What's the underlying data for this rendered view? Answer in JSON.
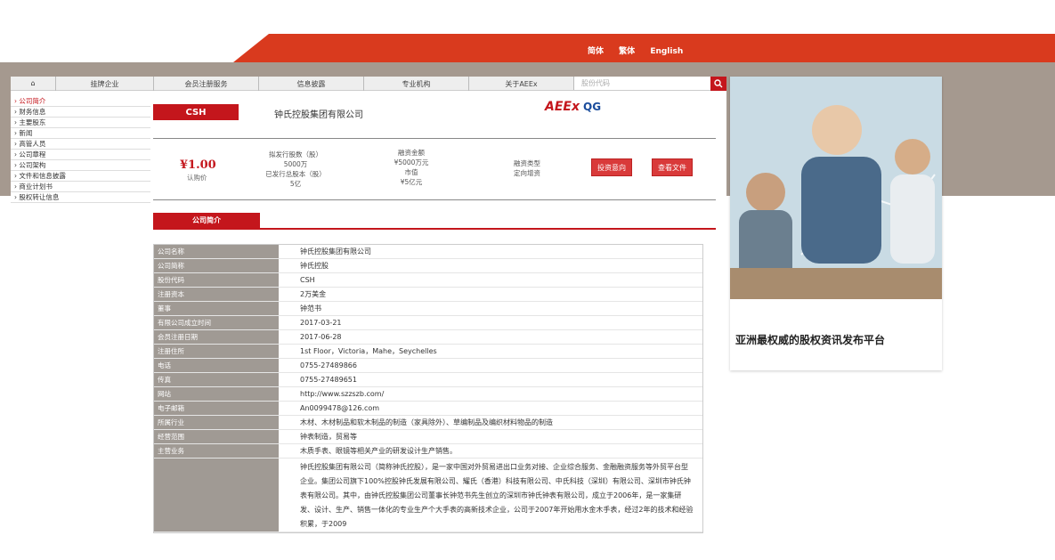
{
  "lang": [
    "简体",
    "繁体",
    "English"
  ],
  "nav": {
    "items": [
      "挂牌企业",
      "会员注册服务",
      "信息披露",
      "专业机构",
      "关于AEEx"
    ],
    "search_placeholder": "股份代码"
  },
  "sidebar": [
    "公司简介",
    "财务信息",
    "主要股东",
    "新闻",
    "高管人员",
    "公司章程",
    "公司架构",
    "文件和信息披露",
    "商业计划书",
    "股权转让信息"
  ],
  "header": {
    "code": "CSH",
    "company": "钟氏控股集团有限公司",
    "logo_aeex": "AEEx",
    "logo_qg": "QG"
  },
  "stats": {
    "price": "¥1.00",
    "price_label": "认购价",
    "col1_l1": "拟发行股数（股）",
    "col1_l2": "5000万",
    "col1_l3": "已发行总股本（股）",
    "col1_l4": "5亿",
    "col2_l1": "融资金额",
    "col2_l2": "¥5000万元",
    "col2_l3": "市值",
    "col2_l4": "¥5亿元",
    "col3_l1": "融资类型",
    "col3_l2": "定向增资",
    "btn_invest": "投资意向",
    "btn_docs": "查看文件"
  },
  "section_tab": "公司简介",
  "table": [
    {
      "k": "公司名称",
      "v": "钟氏控股集团有限公司"
    },
    {
      "k": "公司简称",
      "v": "钟氏控股"
    },
    {
      "k": "股份代码",
      "v": "CSH"
    },
    {
      "k": "注册资本",
      "v": "2万美金"
    },
    {
      "k": "董事",
      "v": "钟范书"
    },
    {
      "k": "有限公司成立时间",
      "v": "2017-03-21"
    },
    {
      "k": "会员注册日期",
      "v": "2017-06-28"
    },
    {
      "k": "注册住所",
      "v": "1st Floor，Victoria，Mahe，Seychelles"
    },
    {
      "k": "电话",
      "v": "0755-27489866"
    },
    {
      "k": "传真",
      "v": "0755-27489651"
    },
    {
      "k": "网站",
      "v": "http://www.szzszb.com/"
    },
    {
      "k": "电子邮箱",
      "v": "An0099478@126.com"
    },
    {
      "k": "所属行业",
      "v": "木材、木材制品和软木制品的制造（家具除外）、草编制品及编织材料物品的制造"
    },
    {
      "k": "经营范围",
      "v": "钟表制造，贸易等"
    },
    {
      "k": "主营业务",
      "v": "木质手表、眼镜等相关产业的研发设计生产销售。"
    }
  ],
  "description": "钟氏控股集团有限公司（简称钟氏控股），是一家中国对外贸易进出口业务对接、企业综合服务、金融融资服务等外贸平台型企业。集团公司旗下100%控股钟氏发展有限公司、耀氏（香港）科技有限公司、中氏科技（深圳）有限公司、深圳市钟氏钟表有限公司。其中，由钟氏控股集团公司董事长钟范书先生创立的深圳市钟氏钟表有限公司，成立于2006年，是一家集研发、设计、生产、销售一体化的专业生产个大手表的高新技术企业，公司于2007年开始用水金木手表，经过2年的技术和经验积累，于2009",
  "ad_caption": "亚洲最权威的股权资讯发布平台"
}
